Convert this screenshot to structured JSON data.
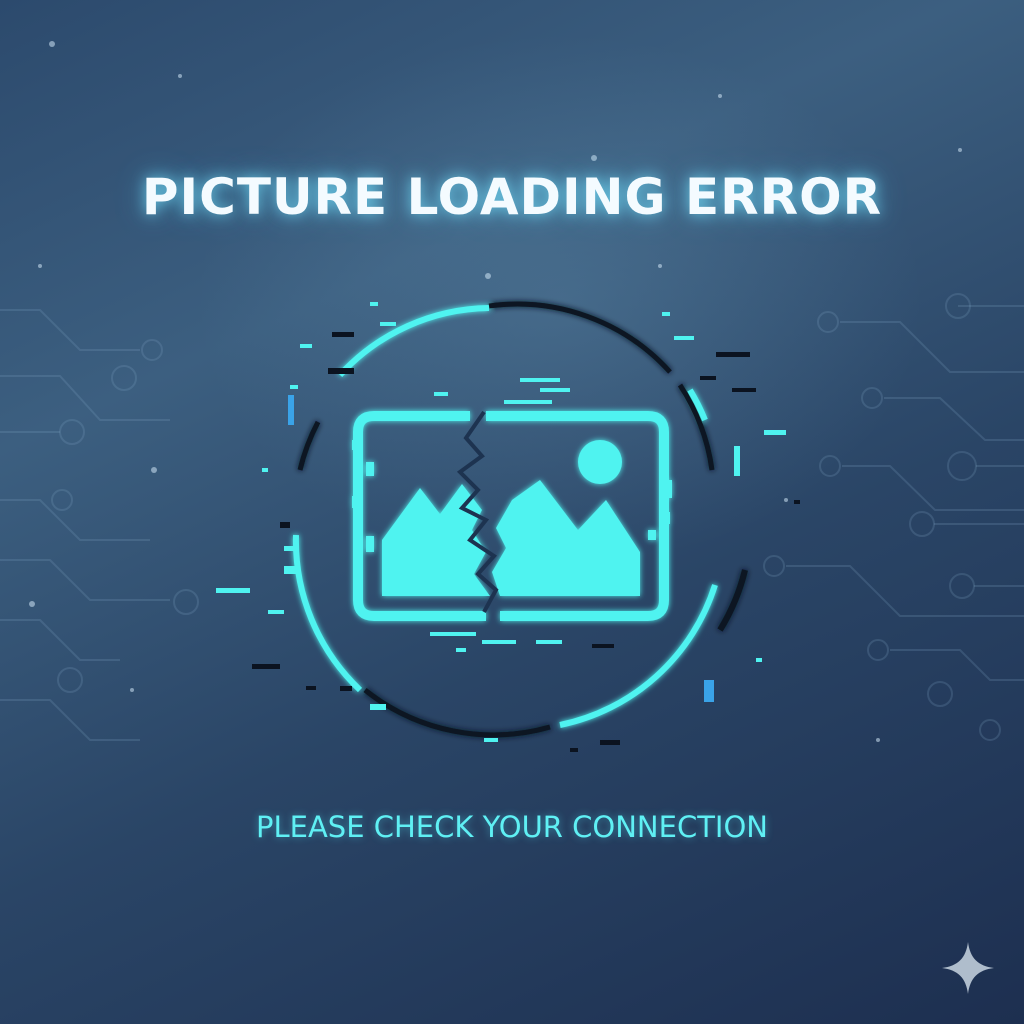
{
  "screen": {
    "title": "PICTURE LOADING ERROR",
    "subtitle": "PLEASE CHECK YOUR CONNECTION"
  },
  "icons": {
    "main": "broken-image-icon",
    "corner": "sparkle-icon"
  },
  "colors": {
    "accent": "#4ff3f0",
    "title_text": "#f4fbff",
    "background_top": "#3c5f80",
    "background_bottom": "#1d2f50"
  }
}
